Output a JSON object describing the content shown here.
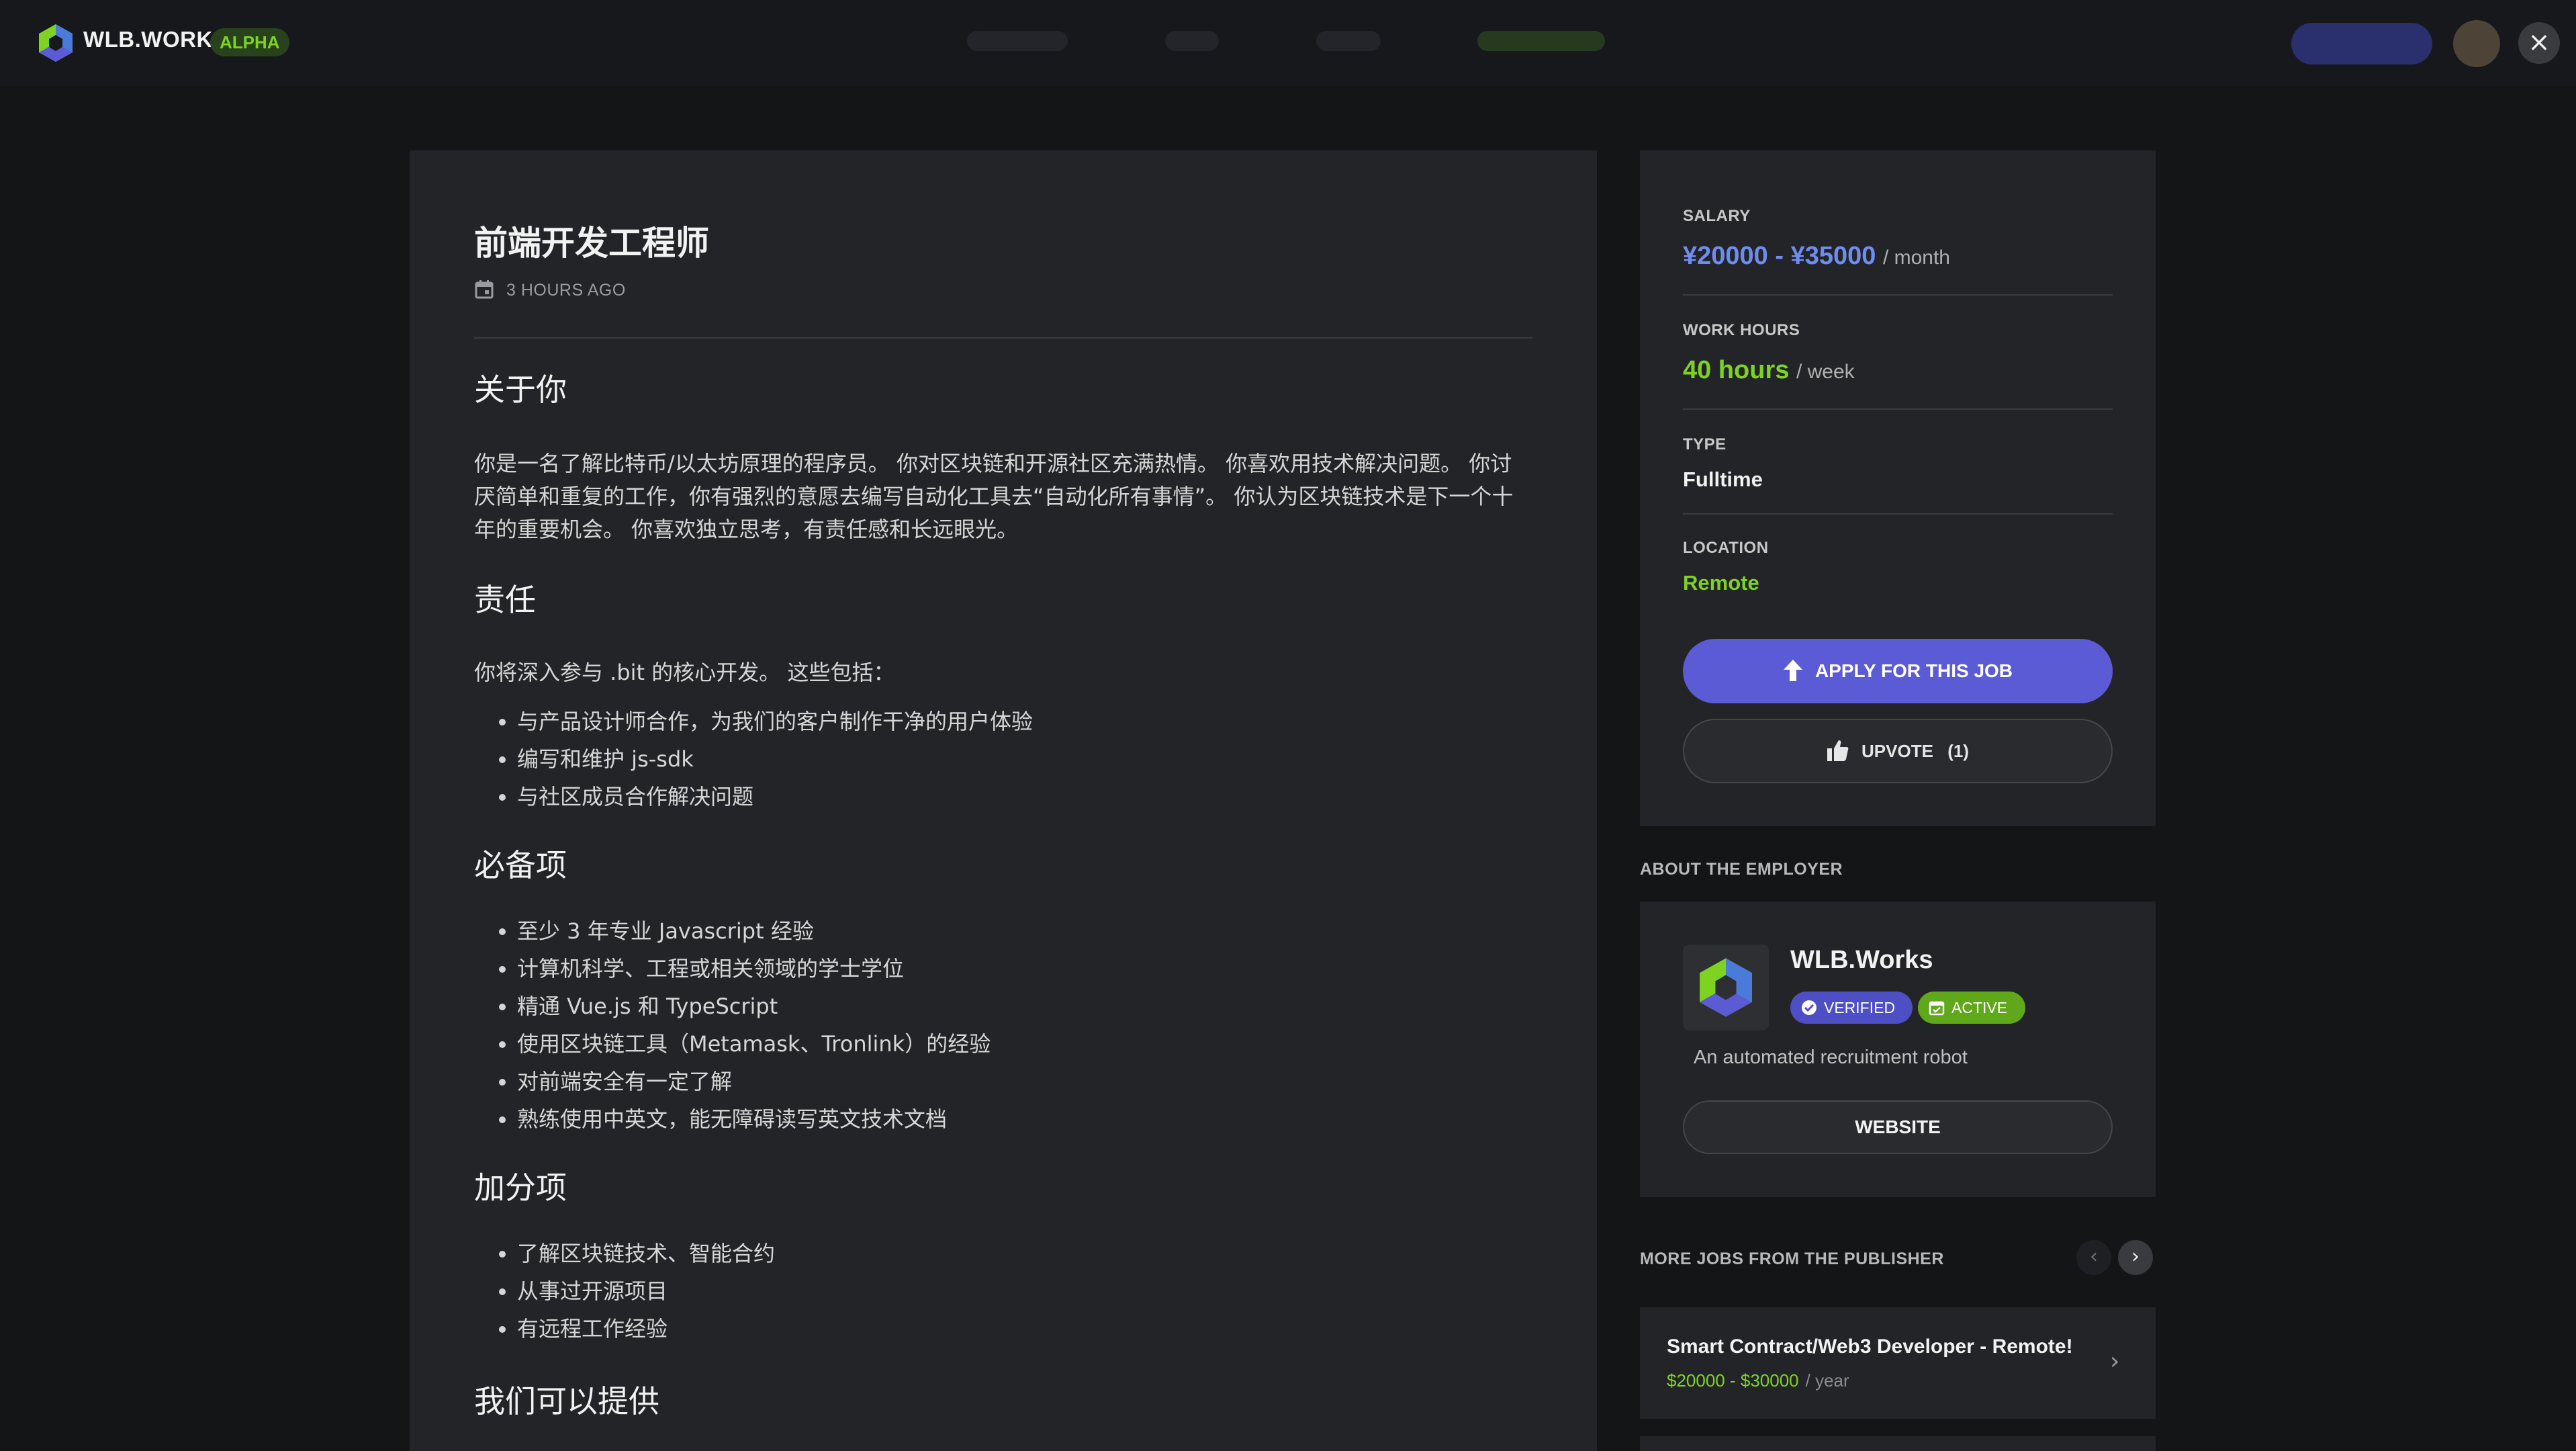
{
  "header": {
    "brand": "WLB.WORKS",
    "badge": "ALPHA",
    "close_icon": "×",
    "logo_colors": [
      "#7ed321",
      "#5b5bd6",
      "#4a7bd8"
    ]
  },
  "job": {
    "title": "前端开发工程师",
    "posted": "3 HOURS AGO",
    "sections": {
      "about_heading": "关于你",
      "about_text": "你是一名了解比特币/以太坊原理的程序员。 你对区块链和开源社区充满热情。 你喜欢用技术解决问题。 你讨厌简单和重复的工作，你有强烈的意愿去编写自动化工具去“自动化所有事情”。 你认为区块链技术是下一个十年的重要机会。 你喜欢独立思考，有责任感和长远眼光。",
      "resp_heading": "责任",
      "resp_intro": "你将深入参与 .bit 的核心开发。 这些包括：",
      "resp_items": [
        "与产品设计师合作，为我们的客户制作干净的用户体验",
        "编写和维护 js-sdk",
        "与社区成员合作解决问题"
      ],
      "req_heading": "必备项",
      "req_items": [
        "至少 3 年专业 Javascript 经验",
        "计算机科学、工程或相关领域的学士学位",
        "精通 Vue.js 和 TypeScript",
        "使用区块链工具（Metamask、Tronlink）的经验",
        "对前端安全有一定了解",
        "熟练使用中英文，能无障碍读写英文技术文档"
      ],
      "bonus_heading": "加分项",
      "bonus_items": [
        "了解区块链技术、智能合约",
        "从事过开源项目",
        "有远程工作经验"
      ],
      "offer_heading": "我们可以提供"
    }
  },
  "sidebar": {
    "salary_label": "SALARY",
    "salary_value": "¥20000 - ¥35000",
    "salary_unit": "/ month",
    "hours_label": "WORK HOURS",
    "hours_value": "40 hours",
    "hours_unit": "/ week",
    "type_label": "TYPE",
    "type_value": "Fulltime",
    "location_label": "LOCATION",
    "location_value": "Remote",
    "apply_label": "APPLY FOR THIS JOB",
    "upvote_label": "UPVOTE",
    "upvote_count": "(1)",
    "colors": {
      "salary": "#6f8cf0",
      "hours": "#7ed321",
      "location": "#7ed321"
    }
  },
  "employer": {
    "section_title": "ABOUT THE EMPLOYER",
    "name": "WLB.Works",
    "verified_label": "VERIFIED",
    "active_label": "ACTIVE",
    "description": "An automated recruitment robot",
    "website_label": "WEBSITE"
  },
  "more_jobs": {
    "section_title": "MORE JOBS FROM THE PUBLISHER",
    "prev_icon": "‹",
    "next_icon": "›",
    "items": [
      {
        "title": "Smart Contract/Web3 Developer - Remote!",
        "salary": "$20000 - $30000",
        "unit": "/ year"
      }
    ]
  }
}
